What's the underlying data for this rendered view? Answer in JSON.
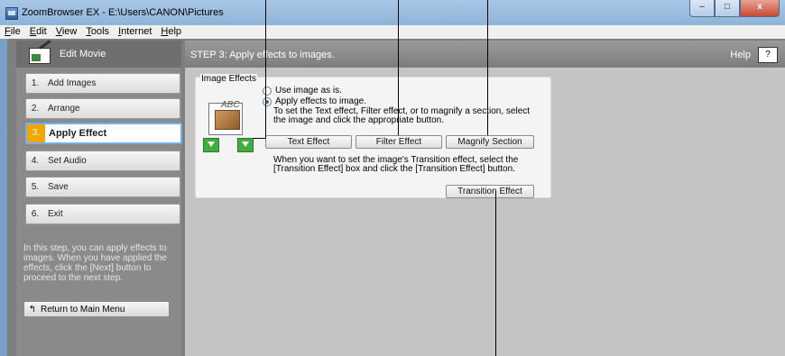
{
  "window": {
    "title": "ZoomBrowser EX - E:\\Users\\CANON\\Pictures",
    "controls": [
      "–",
      "□",
      "x"
    ]
  },
  "menu": [
    "File",
    "Edit",
    "View",
    "Tools",
    "Internet",
    "Help"
  ],
  "sidebar": {
    "title": "Edit Movie",
    "steps": [
      {
        "num": "1.",
        "label": "Add Images"
      },
      {
        "num": "2.",
        "label": "Arrange"
      },
      {
        "num": "3.",
        "label": "Apply Effect"
      },
      {
        "num": "4.",
        "label": "Set Audio"
      },
      {
        "num": "5.",
        "label": "Save"
      },
      {
        "num": "6.",
        "label": "Exit"
      }
    ],
    "active_step": 3,
    "help_text": "In this step, you can apply effects to images. When you have applied the effects, click the [Next] button to proceed to the next step.",
    "return_label": "Return to Main Menu"
  },
  "main": {
    "step_title": "STEP 3: Apply effects to images.",
    "help_label": "Help",
    "help_button": "?",
    "image_effects": {
      "title": "Image Effects",
      "icon_text": "ABC",
      "option_as_is": "Use image as is.",
      "option_apply": "Apply effects to image.",
      "apply_selected": true,
      "instruction": "To set the Text effect, Filter effect, or to magnify a section, select the image and click the appropriate button.",
      "buttons": {
        "text_effect": "Text Effect",
        "filter_effect": "Filter Effect",
        "magnify_section": "Magnify Section"
      },
      "transition_instruction": "When you want to set the image's Transition effect, select the [Transition Effect] box and click the [Transition Effect] button.",
      "transition_button": "Transition Effect"
    }
  },
  "colors": {
    "active_step_number": "#f5a500",
    "active_step_border": "#6fb0e8",
    "sidebar_bg": "#8a8a8a",
    "main_bg": "#c4c4c4"
  }
}
